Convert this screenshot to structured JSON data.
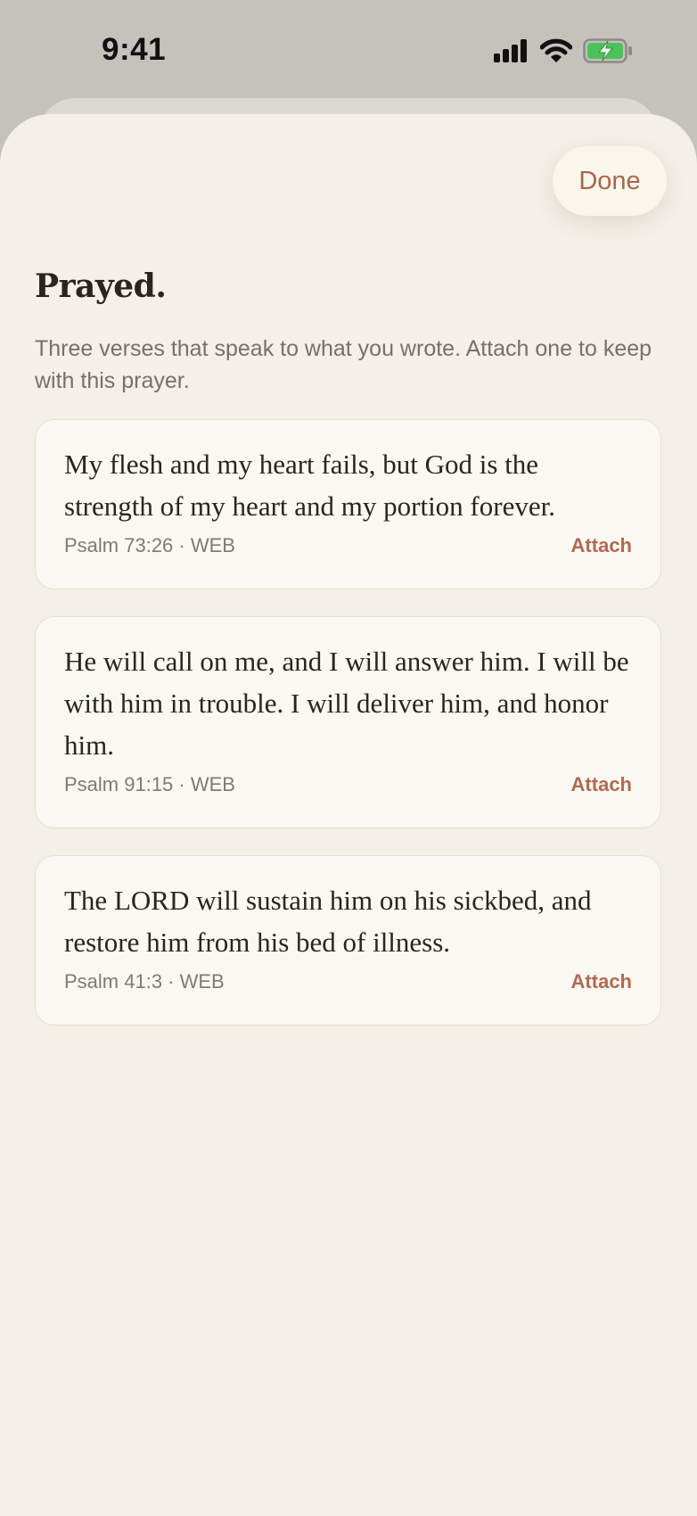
{
  "status_bar": {
    "time": "9:41"
  },
  "header": {
    "done_label": "Done",
    "title": "Prayed.",
    "subtitle": "Three verses that speak to what you wrote. Attach one to keep with this prayer."
  },
  "verses": [
    {
      "text": "My flesh and my heart fails, but God is the strength of my heart and my portion forever.",
      "reference": "Psalm 73:26 · WEB",
      "action": "Attach"
    },
    {
      "text": "He will call on me, and I will answer him. I will be with him in trouble. I will deliver him, and honor him.",
      "reference": "Psalm 91:15 · WEB",
      "action": "Attach"
    },
    {
      "text": "The LORD will sustain him on his sickbed, and restore him from his bed of illness.",
      "reference": "Psalm 41:3 · WEB",
      "action": "Attach"
    }
  ],
  "colors": {
    "accent": "#a8664c",
    "battery": "#4cc35a",
    "background": "#f4efe7"
  }
}
